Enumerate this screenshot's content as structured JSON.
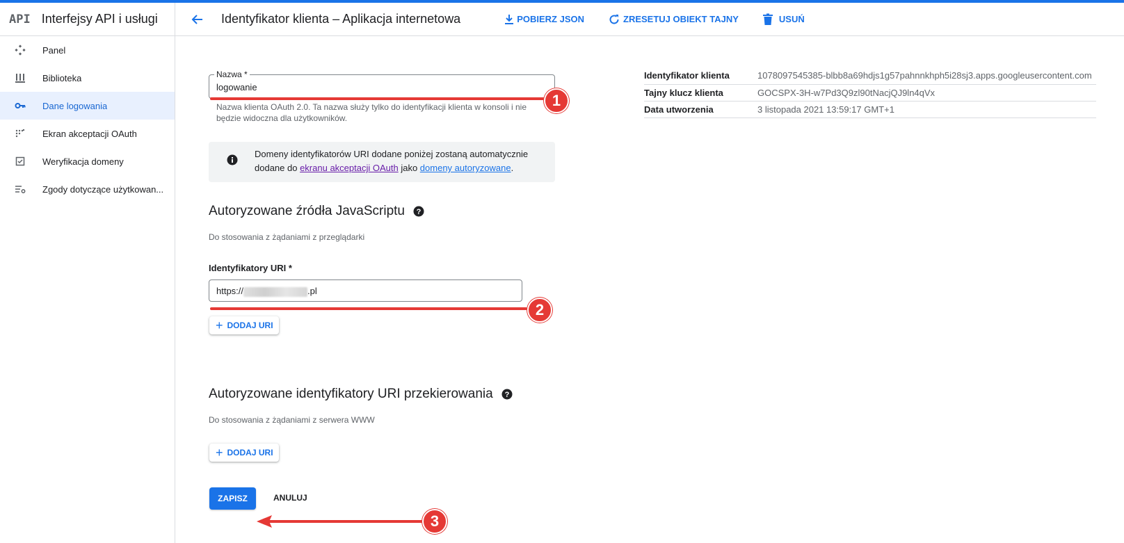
{
  "app": {
    "logo_text": "API",
    "title": "Interfejsy API i usługi",
    "accent_color": "#1a73e8",
    "annotation_color": "#e53935"
  },
  "sidebar": {
    "items": [
      {
        "label": "Panel",
        "icon": "diamond-dots-icon",
        "active": false
      },
      {
        "label": "Biblioteka",
        "icon": "library-icon",
        "active": false
      },
      {
        "label": "Dane logowania",
        "icon": "key-icon",
        "active": true
      },
      {
        "label": "Ekran akceptacji OAuth",
        "icon": "dots-grid-icon",
        "active": false
      },
      {
        "label": "Weryfikacja domeny",
        "icon": "checkbox-icon",
        "active": false
      },
      {
        "label": "Zgody dotyczące użytkowan...",
        "icon": "list-settings-icon",
        "active": false
      }
    ]
  },
  "header": {
    "title": "Identyfikator klienta – Aplikacja internetowa",
    "download_label": "POBIERZ JSON",
    "reset_label": "ZRESETUJ OBIEKT TAJNY",
    "delete_label": "USUŃ"
  },
  "form": {
    "name_label": "Nazwa *",
    "name_value": "logowanie",
    "name_hint": "Nazwa klienta OAuth 2.0. Ta nazwa służy tylko do identyfikacji klienta w konsoli i nie będzie widoczna dla użytkowników.",
    "info_part1": "Domeny identyfikatorów URI dodane poniżej zostaną automatycznie dodane do ",
    "info_link1": "ekranu akceptacji OAuth",
    "info_part2": " jako ",
    "info_link2": "domeny autoryzowane",
    "info_part3": "."
  },
  "js_origins": {
    "title": "Autoryzowane źródła JavaScriptu",
    "subtitle": "Do stosowania z żądaniami z przeglądarki",
    "uri_label": "Identyfikatory URI *",
    "uri_prefix": "https://",
    "uri_suffix": ".pl",
    "add_label": "DODAJ URI"
  },
  "redirect_uris": {
    "title": "Autoryzowane identyfikatory URI przekierowania",
    "subtitle": "Do stosowania z żądaniami z serwera WWW",
    "add_label": "DODAJ URI"
  },
  "actions": {
    "save_label": "ZAPISZ",
    "cancel_label": "ANULUJ"
  },
  "details": {
    "rows": [
      {
        "key": "Identyfikator klienta",
        "value": "1078097545385-blbb8a69hdjs1g57pahnnkhph5i28sj3.apps.googleusercontent.com"
      },
      {
        "key": "Tajny klucz klienta",
        "value": "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"
      },
      {
        "key": "Data utworzenia",
        "value": "3 listopada 2021 13:59:17 GMT+1"
      }
    ]
  },
  "annotations": {
    "badge1": "1",
    "badge2": "2",
    "badge3": "3"
  }
}
